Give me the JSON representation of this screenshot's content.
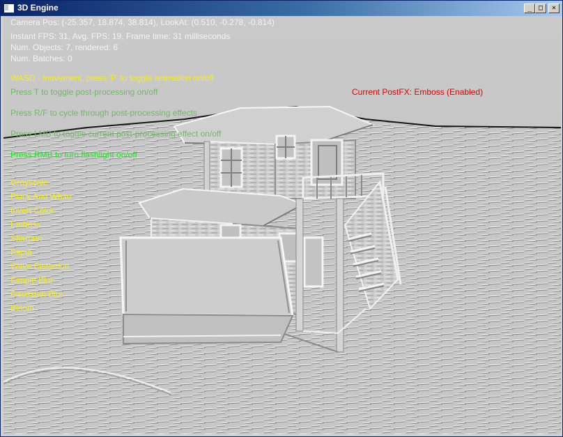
{
  "window": {
    "title": "3D Engine",
    "minimize_glyph": "_",
    "maximize_glyph": "□",
    "close_glyph": "×"
  },
  "hud": {
    "camera": "Camera Pos: (-25.357, 18.874, 38.814), LookAt: (0.510, -0.278, -0.814)",
    "fps": "Instant FPS: 31, Avg. FPS: 19, Frame time: 31 milliseconds",
    "objects": "Num. Objects: 7, rendered: 6",
    "batches": "Num. Batches: 0",
    "hint_wasd": "WASD - movement, press 'P' to toggle animation on/off",
    "hint_t": "Press T to toggle post-processing on/off",
    "hint_rf": "Press R/F to cycle through post-processing effects",
    "hint_lmb": "Press LMB to toggle current post-processing effect on/off",
    "hint_rmb": "Press RMB to turn flashlight on/off",
    "current_postfx": "Current PostFX: Emboss (Enabled)"
  },
  "effects": [
    "Grayscale",
    "Black And White",
    "Invert Color",
    "Emboss",
    "Sharpen",
    "Sepia",
    "Wave Distortion",
    "Simple Blur",
    "Gaussian Blur",
    "Bloom"
  ],
  "colors": {
    "title_bar_start": "#0a246a",
    "title_bar_end": "#a6caf0",
    "hud_white": "#f4f4f4",
    "hud_yellow": "#f2ef18",
    "hud_green": "#19e81c",
    "hud_red": "#e00000",
    "emboss_gray": "#c7c7c7"
  },
  "icons": {
    "app": "window-app-icon",
    "minimize": "minimize-icon",
    "maximize": "maximize-icon",
    "close": "close-icon"
  }
}
